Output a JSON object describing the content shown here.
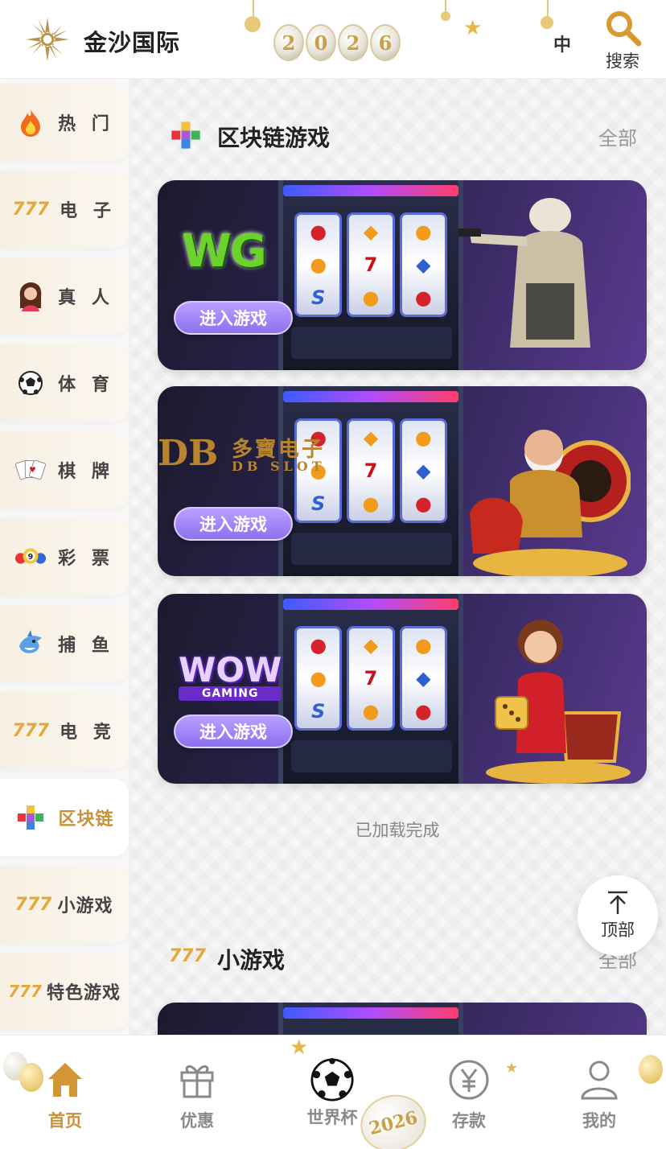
{
  "header": {
    "brand": "金沙国际",
    "year_digits": [
      "2",
      "0",
      "2",
      "6"
    ],
    "lang": "中",
    "search_label": "搜索"
  },
  "sidebar": {
    "items": [
      {
        "label": "热 门",
        "icon": "flame-icon",
        "active": false
      },
      {
        "label": "电 子",
        "icon": "777-slot-icon",
        "active": false
      },
      {
        "label": "真 人",
        "icon": "live-dealer-icon",
        "active": false
      },
      {
        "label": "体 育",
        "icon": "soccer-ball-icon",
        "active": false
      },
      {
        "label": "棋 牌",
        "icon": "playing-cards-icon",
        "active": false
      },
      {
        "label": "彩 票",
        "icon": "lottery-balls-icon",
        "active": false
      },
      {
        "label": "捕 鱼",
        "icon": "shark-icon",
        "active": false
      },
      {
        "label": "电 竞",
        "icon": "777-slot-icon",
        "active": false
      },
      {
        "label": "区块链",
        "icon": "blockchain-cubes-icon",
        "active": true
      },
      {
        "label": "小游戏",
        "icon": "777-slot-icon",
        "active": false
      },
      {
        "label": "特色游戏",
        "icon": "777-slot-icon",
        "active": false
      }
    ]
  },
  "sections": {
    "blockchain": {
      "title": "区块链游戏",
      "all_label": "全部",
      "icon": "blockchain-cubes-icon"
    },
    "mini": {
      "title": "小游戏",
      "all_label": "全部",
      "icon": "777-slot-icon"
    }
  },
  "cards": [
    {
      "logo": "WG",
      "button": "进入游戏"
    },
    {
      "logo_mark": "DB",
      "logo_cn": "多寶电子",
      "logo_en": "DB SLOT",
      "button": "进入游戏"
    },
    {
      "logo": "WOW",
      "logo_sub": "GAMING",
      "button": "进入游戏"
    }
  ],
  "reel_symbols": [
    "7",
    "S"
  ],
  "loaded_text": "已加载完成",
  "to_top_label": "顶部",
  "bottom_nav": {
    "items": [
      {
        "label": "首页",
        "icon": "home-icon",
        "active": true
      },
      {
        "label": "优惠",
        "icon": "gift-icon",
        "active": false
      },
      {
        "label": "世界杯",
        "icon": "soccer-ball-icon",
        "active": false
      },
      {
        "label": "存款",
        "icon": "yen-coin-icon",
        "active": false
      },
      {
        "label": "我的",
        "icon": "user-icon",
        "active": false
      }
    ],
    "badge_year": "2026"
  },
  "colors": {
    "accent": "#c8903a",
    "button_purple": "#9b7ff4",
    "muted_text": "#888888"
  }
}
